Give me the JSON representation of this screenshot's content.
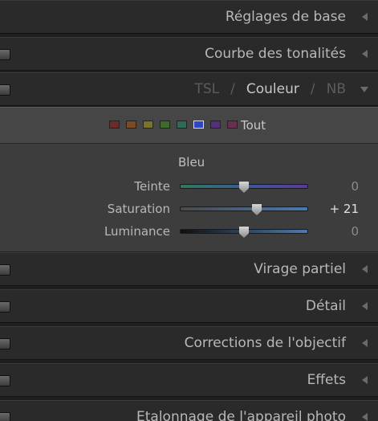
{
  "panels": {
    "basic": "Réglages de base",
    "tone_curve": "Courbe des tonalités",
    "split_toning": "Virage partiel",
    "detail": "Détail",
    "lens": "Corrections de l'objectif",
    "effects": "Effets",
    "calibration": "Etalonnage de l'appareil photo"
  },
  "hsl_tabs": {
    "tsl": "TSL",
    "color": "Couleur",
    "bw": "NB",
    "separator": "/",
    "active": "color"
  },
  "color_chips": {
    "colors": [
      "#6e2a2a",
      "#7a4a22",
      "#7a7428",
      "#3e6a2e",
      "#2e6a5a",
      "#2f45c8",
      "#55307a",
      "#6a2e52"
    ],
    "selected_index": 5,
    "all_label": "Tout"
  },
  "color_name": "Bleu",
  "sliders": [
    {
      "label": "Teinte",
      "value": "0",
      "position": 0.5,
      "changed": false,
      "gradient": "linear-gradient(to right, #2f7a5a, #3a5a9a 50%, #5a3a9a)"
    },
    {
      "label": "Saturation",
      "value": "+ 21",
      "position": 0.6,
      "changed": true,
      "gradient": "linear-gradient(to right, #4a4a4a, #4a7ab0)"
    },
    {
      "label": "Luminance",
      "value": "0",
      "position": 0.5,
      "changed": false,
      "gradient": "linear-gradient(to right, #101010, #4a7ab0)"
    }
  ]
}
